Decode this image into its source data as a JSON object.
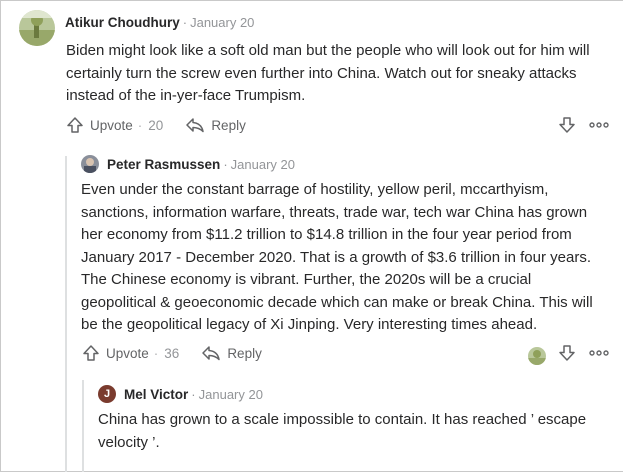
{
  "comments": [
    {
      "author": "Atikur Choudhury",
      "separator": "·",
      "date": "January 20",
      "text": "Biden might look like a soft old man but the people who will look out for him will certainly turn the screw even further into China. Watch out for sneaky attacks instead of the in-yer-face Trumpism.",
      "upvote_label": "Upvote",
      "upvote_dot": "·",
      "upvote_count": "20",
      "reply_label": "Reply",
      "avatar_icon": "landscape-avatar"
    },
    {
      "author": "Peter Rasmussen",
      "separator": "·",
      "date": "January 20",
      "text": "Even under the constant barrage of hostility, yellow peril, mccarthyism, sanctions, information warfare, threats, trade war, tech war China has grown her economy from $11.2 trillion to $14.8 trillion in the four year period from January 2017 - December 2020. That is a growth of $3.6 trillion in four years. The Chinese economy is vibrant. Further, the 2020s will be a crucial geopolitical & geoeconomic decade which can make or break China. This will be the geopolitical legacy of Xi Jinping. Very interesting times ahead.",
      "upvote_label": "Upvote",
      "upvote_dot": "·",
      "upvote_count": "36",
      "reply_label": "Reply",
      "avatar_icon": "photo-avatar"
    },
    {
      "author": "Mel Victor",
      "separator": "·",
      "date": "January 20",
      "avatar_letter": "J",
      "text": "China has grown to a scale impossible to contain. It has reached ’ escape velocity ’."
    }
  ],
  "colors": {
    "text": "#282829",
    "muted": "#939598",
    "icon": "#636466",
    "letter_avatar": "#7a3b2e"
  }
}
